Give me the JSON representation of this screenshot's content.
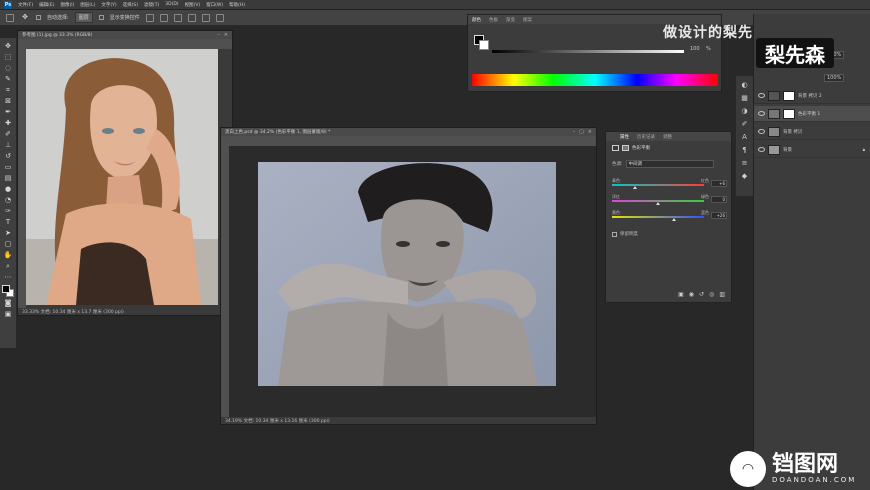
{
  "menubar": {
    "logo": "Ps",
    "items": [
      "文件(F)",
      "编辑(E)",
      "图像(I)",
      "图层(L)",
      "文字(Y)",
      "选择(S)",
      "滤镜(T)",
      "3D(D)",
      "视图(V)",
      "窗口(W)",
      "帮助(H)"
    ]
  },
  "options": {
    "auto_select_label": "自动选择:",
    "auto_select_value": "图层",
    "transform_label": "显示变换控件"
  },
  "doc1": {
    "title": "参考图 (1).jpg @ 33.3% (RGB/8)",
    "status": "33.33%   文档: 10.34 厘米 x 13.7 厘米 (300 ppi)"
  },
  "doc2": {
    "title": "黑白上色.psd @ 34.2% (色彩平衡 1, 图层蒙版/8) *",
    "status": "34.19%   文档: 10.34 厘米 x 13.16 厘米 (300 ppi)"
  },
  "color_panel": {
    "tabs": [
      "颜色",
      "色板",
      "渐变",
      "图案"
    ],
    "value": "100",
    "unit": "%"
  },
  "properties": {
    "tabs": [
      "属性",
      "历史记录",
      "调整"
    ],
    "title": "色彩平衡",
    "tone_label": "色调:",
    "tone_value": "中间调",
    "sliders": [
      {
        "left": "青色",
        "right": "红色",
        "value": "+6",
        "pos": 0.25,
        "gradient": "linear-gradient(to right,#00c8c8,#ff3b3b)"
      },
      {
        "left": "洋红",
        "right": "绿色",
        "value": "0",
        "pos": 0.5,
        "gradient": "linear-gradient(to right,#e040e0,#38d038)"
      },
      {
        "left": "黄色",
        "right": "蓝色",
        "value": "+26",
        "pos": 0.67,
        "gradient": "linear-gradient(to right,#e8e000,#3050ff)"
      }
    ],
    "preserve_label": "保留明度"
  },
  "layers": {
    "opacity": "100%",
    "fill": "100%",
    "rows": [
      {
        "name": "背景 拷贝 2"
      },
      {
        "name": "色彩平衡 1"
      },
      {
        "name": "背景 拷贝"
      },
      {
        "name": "背景"
      }
    ]
  },
  "watermark": {
    "top_text": "做设计的梨先生",
    "badge": "梨先森",
    "bottom_title": "铛图网",
    "bottom_sub": "DOANDOAN.COM"
  }
}
